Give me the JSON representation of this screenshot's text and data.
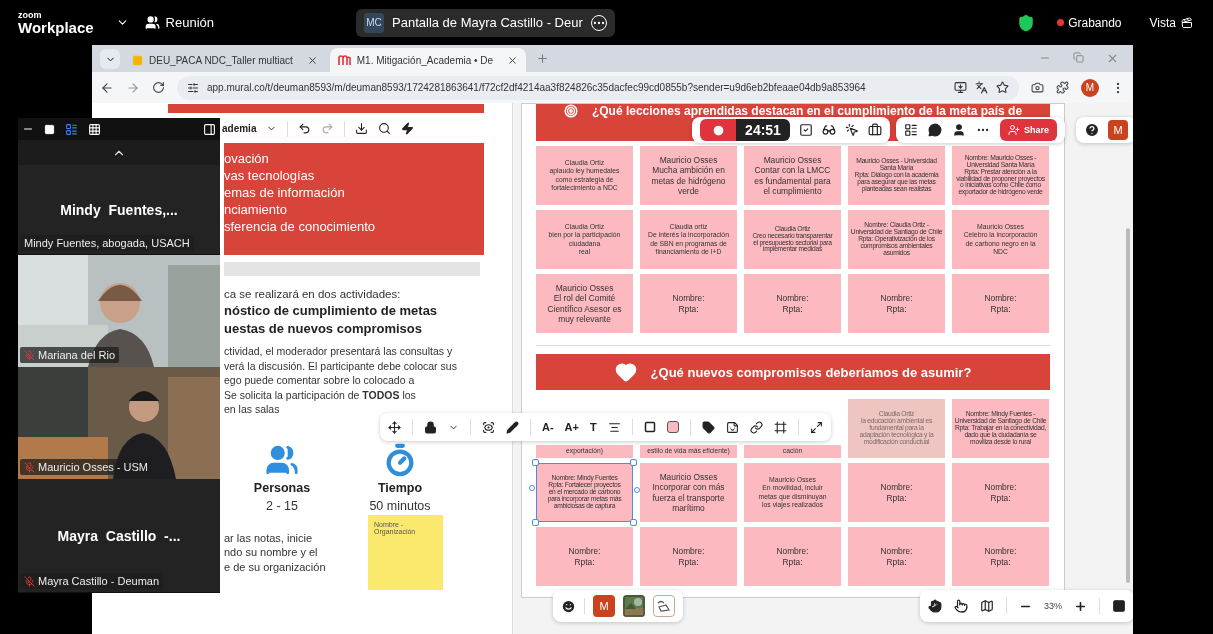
{
  "zoom_bar": {
    "brand_small": "zoom",
    "brand": "Workplace",
    "meeting": "Reunión",
    "share_avatar": "MC",
    "share_title": "Pantalla de Mayra Castillo - Deur",
    "recording": "Grabando",
    "view": "Vista"
  },
  "browser": {
    "tabs": [
      {
        "title": "DEU_PACA NDC_Taller multiact",
        "kind": "slides",
        "selected": false
      },
      {
        "title": "M1. Mitigación_Academia • De",
        "kind": "mural",
        "selected": true
      }
    ],
    "address": "app.mural.co/t/deuman8593/m/deuman8593/1724281863641/f72cf2df4214aa3f824826c35dacfec99cd0855b?sender=u9d6eb2bfeaae04db9a853964",
    "profile": "M"
  },
  "participants_panel": {
    "participants": [
      {
        "kind": "name",
        "title": "Mindy  Fuentes,...",
        "label": "Mindy Fuentes, abogada, USACH",
        "muted": false
      },
      {
        "kind": "video",
        "label": "Mariana del Rio",
        "muted": true
      },
      {
        "kind": "video",
        "label": "Mauricio Osses - USM",
        "muted": true
      },
      {
        "kind": "name",
        "title": "Mayra  Castillo  -...",
        "label": "Mayra Castillo - Deuman",
        "muted": true
      }
    ]
  },
  "mural_toolbar": {
    "timer": "24:51",
    "share": "Share",
    "avatar": "M"
  },
  "left_panel": {
    "mini_toolbar_label": "ademia",
    "topics": [
      "ovación",
      "vas tecnologías",
      "emas de información",
      "nciamiento",
      "sferencia de conocimiento"
    ],
    "intro": "ca se realizará en dos actividades:",
    "activities": [
      "nóstico de cumplimiento de metas",
      "uestas de nuevos compromisos"
    ],
    "paragraph": "ctividad, el moderador presentará las consultas y\nverá la discusión. El participante debe colocar sus\nego puede comentar sobre lo colocado a\nSe solicita la participación de **TODOS** los\nen las salas",
    "stats": [
      {
        "kind": "people",
        "label": "Personas",
        "value": "2 - 15"
      },
      {
        "kind": "time",
        "label": "Tiempo",
        "value": "50 minutos"
      }
    ],
    "instructions": "ar las notas, inicie\nndo su nombre y el\ne de su organización",
    "sample_note": "Nombre -\nOrganización"
  },
  "board": {
    "sections": [
      {
        "kind": "target",
        "title": "¿Qué lecciones aprendidas destacan en el cumplimiento de la meta país de",
        "notes": [
          {
            "text": "Claudia Ortiz\naplaudo ley humedales\ncomo estrategia de\nfortalecimiento a NDC",
            "kind": "small",
            "faded": false,
            "selected": false
          },
          {
            "text": "Mauricio Osses\nMucha ambición en\nmetas de hidrógeno\nverde",
            "kind": "large",
            "faded": false,
            "selected": false
          },
          {
            "text": "Mauricio Osses\nContar con la LMCC\nes fundamental para\nel cumplimiento",
            "kind": "large",
            "faded": false,
            "selected": false
          },
          {
            "text": "Mauricio Osses - Universidad\nSanta María\nRpta: Diálogo con la academia\npara asegurar que las metas\nplanteadas sean realistas",
            "kind": "tiny",
            "faded": false,
            "selected": false
          },
          {
            "text": "Nombre: Mauricio Osses -\nUniversidad Santa María\nRpta: Prestar atención a la\nviabilidad de proponer proyectos\no iniciativas como Chile como\nexportador de hidrógeno verde",
            "kind": "tiny",
            "faded": false,
            "selected": false
          },
          {
            "text": "Claudia Ortiz\nbien por la participación\nciudadana\nreal",
            "kind": "small",
            "faded": false,
            "selected": false
          },
          {
            "text": "Claudia ortiz\nDe interés la incorporación\nde SBN en programas de\nfinanciamiento de I+D",
            "kind": "small",
            "faded": false,
            "selected": false
          },
          {
            "text": "Claudia Ortiz\nCreo necesario transparentar\nel presupuesto sectorial para\nimplementar medidas",
            "kind": "tiny",
            "faded": false,
            "selected": false
          },
          {
            "text": "Nombre: Claudia Ortiz -\nUniversidad de Santiago de Chile\nRpta: Operativización de los\ncompromisos ambientales\nasumidos",
            "kind": "tiny",
            "faded": false,
            "selected": false
          },
          {
            "text": "Mauricio Osses\nCelebro la incorporación\nde carbono negro en la\nNDC",
            "kind": "small",
            "faded": false,
            "selected": false
          },
          {
            "text": "Mauricio Osses\nEl rol del Comité\nCientífico Asesor es\nmuy relevante",
            "kind": "large",
            "faded": false,
            "selected": false
          },
          {
            "text": "Nombre:\nRpta:",
            "kind": "large",
            "faded": false,
            "selected": false
          },
          {
            "text": "Nombre:\nRpta:",
            "kind": "large",
            "faded": false,
            "selected": false
          },
          {
            "text": "Nombre:\nRpta:",
            "kind": "large",
            "faded": false,
            "selected": false
          },
          {
            "text": "Nombre:\nRpta:",
            "kind": "large",
            "faded": false,
            "selected": false
          }
        ]
      },
      {
        "kind": "heart",
        "title": "¿Qué nuevos compromisos deberíamos de asumir?",
        "notes": [
          {
            "text": "exportación)",
            "kind": "covered",
            "faded": false,
            "selected": false
          },
          {
            "text": "estilo de vida más eficiente)",
            "kind": "covered",
            "faded": false,
            "selected": false
          },
          {
            "text": "cación",
            "kind": "covered",
            "faded": false,
            "selected": false
          },
          {
            "text": "Claudia Ortiz\nla educación ambiental es\nfundamental para la\nadaptación tecnológica y la\nmodificación conductual",
            "kind": "tiny",
            "faded": true,
            "selected": false
          },
          {
            "text": "Nombre: Mindy Fuentes -\nUniversidad de Santiago de Chile\nRpta: Trabajar en la conectividad,\ndado que la ciudadanía se\nmoviliza desde lo rural",
            "kind": "tiny",
            "faded": false,
            "selected": false
          },
          {
            "text": "Nombre: Mindy Fuentes\nRpta: Fortalecer proyectos\nen el mercado de carbono\npara incorporar metas más\nambiciosas de captura",
            "kind": "tiny",
            "faded": false,
            "selected": true
          },
          {
            "text": "Mauricio Osses\nIncorporar con más\nfuerza el transporte\nmarítimo",
            "kind": "large",
            "faded": false,
            "selected": false
          },
          {
            "text": "Mauricio Osses\nEn movilidad, incluir\nmetas que disminuyan\nlos viajes realizados",
            "kind": "small",
            "faded": false,
            "selected": false
          },
          {
            "text": "Nombre:\nRpta:",
            "kind": "large",
            "faded": false,
            "selected": false
          },
          {
            "text": "Nombre:\nRpta:",
            "kind": "large",
            "faded": false,
            "selected": false
          },
          {
            "text": "Nombre:\nRpta:",
            "kind": "large",
            "faded": false,
            "selected": false
          },
          {
            "text": "Nombre:\nRpta:",
            "kind": "large",
            "faded": false,
            "selected": false
          },
          {
            "text": "Nombre:\nRpta:",
            "kind": "large",
            "faded": false,
            "selected": false
          },
          {
            "text": "Nombre:\nRpta:",
            "kind": "large",
            "faded": false,
            "selected": false
          },
          {
            "text": "Nombre:\nRpta:",
            "kind": "large",
            "faded": false,
            "selected": false
          }
        ]
      }
    ]
  },
  "object_toolbar": {
    "text_buttons": [
      "A-",
      "A+",
      "T"
    ]
  },
  "bottom_bar": {
    "avatar": "M",
    "zoom": "33%"
  }
}
